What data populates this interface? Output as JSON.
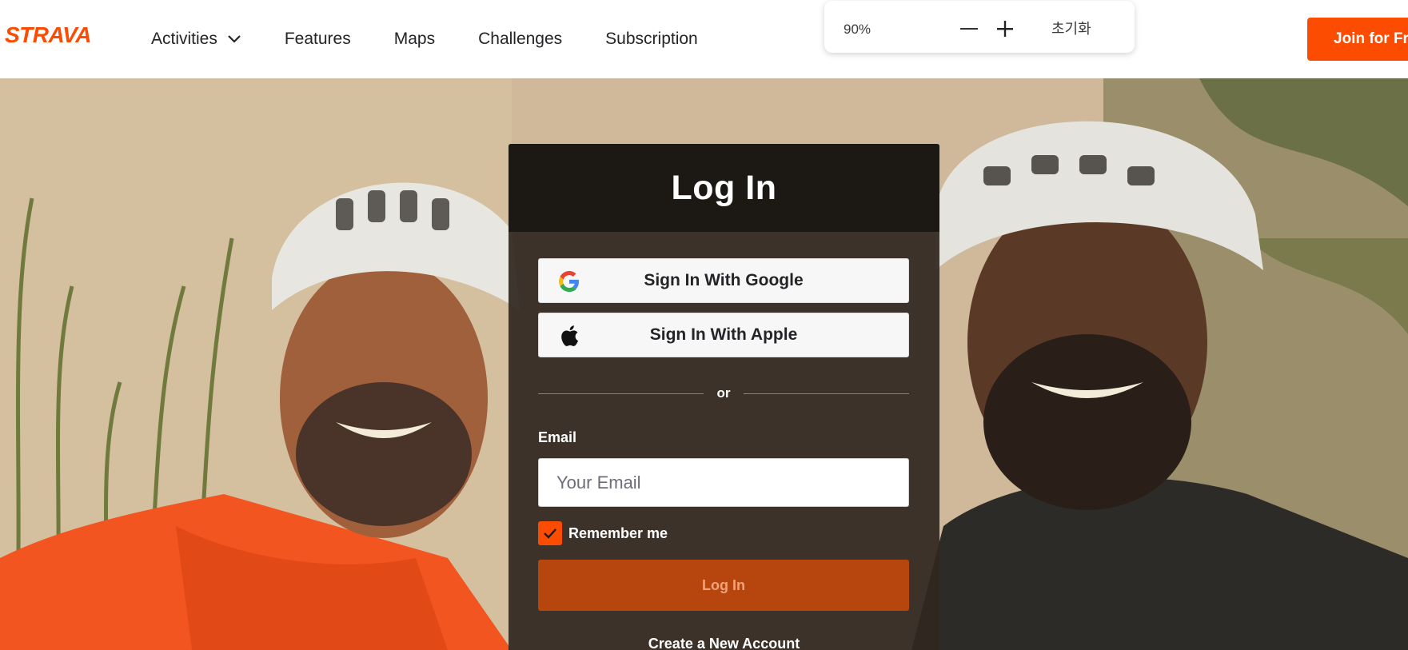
{
  "brand": {
    "name": "STRAVA",
    "color": "#fc4c02"
  },
  "nav": {
    "items": [
      {
        "label": "Activities",
        "has_dropdown": true
      },
      {
        "label": "Features"
      },
      {
        "label": "Maps"
      },
      {
        "label": "Challenges"
      },
      {
        "label": "Subscription"
      }
    ],
    "join_label": "Join for Free"
  },
  "zoom_popup": {
    "level": "90%",
    "minus_icon": "minus-icon",
    "plus_icon": "plus-icon",
    "reset_label": "초기화"
  },
  "login": {
    "title": "Log In",
    "google_label": "Sign In With Google",
    "apple_label": "Sign In With Apple",
    "divider_text": "or",
    "email_label": "Email",
    "email_placeholder": "Your Email",
    "email_value": "",
    "remember_label": "Remember me",
    "remember_checked": true,
    "submit_label": "Log In",
    "create_account_label": "Create a New Account"
  },
  "colors": {
    "accent": "#fc4c02",
    "login_button": "#b7460e",
    "card_background": "#302820"
  }
}
